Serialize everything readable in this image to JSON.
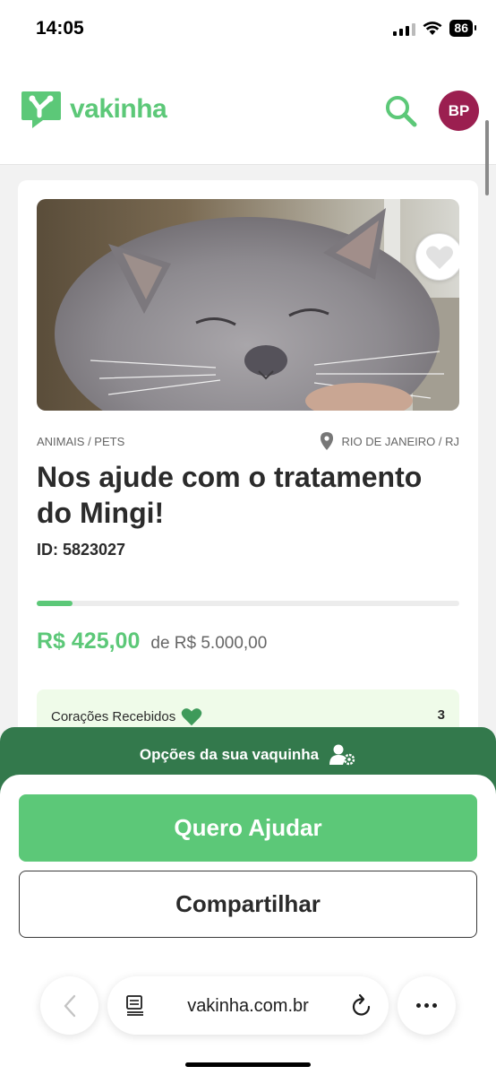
{
  "status_bar": {
    "time": "14:05",
    "battery": "86"
  },
  "header": {
    "logo_text": "vakinha",
    "avatar_initials": "BP"
  },
  "campaign": {
    "category": "ANIMAIS / PETS",
    "location": "RIO DE JANEIRO / RJ",
    "title": "Nos ajude com o tratamento do Mingi!",
    "id_label": "ID: 5823027",
    "progress_fraction": 0.085,
    "raised": "R$ 425,00",
    "goal": "de R$ 5.000,00",
    "hearts_label": "Corações Recebidos",
    "hearts_count": "3"
  },
  "options_bar": {
    "label": "Opções da sua vaquinha"
  },
  "actions": {
    "help_label": "Quero Ajudar",
    "share_label": "Compartilhar"
  },
  "browser": {
    "url": "vakinha.com.br"
  },
  "colors": {
    "brand_green": "#5cc878",
    "dark_green": "#33794c",
    "avatar": "#9b1f50"
  }
}
